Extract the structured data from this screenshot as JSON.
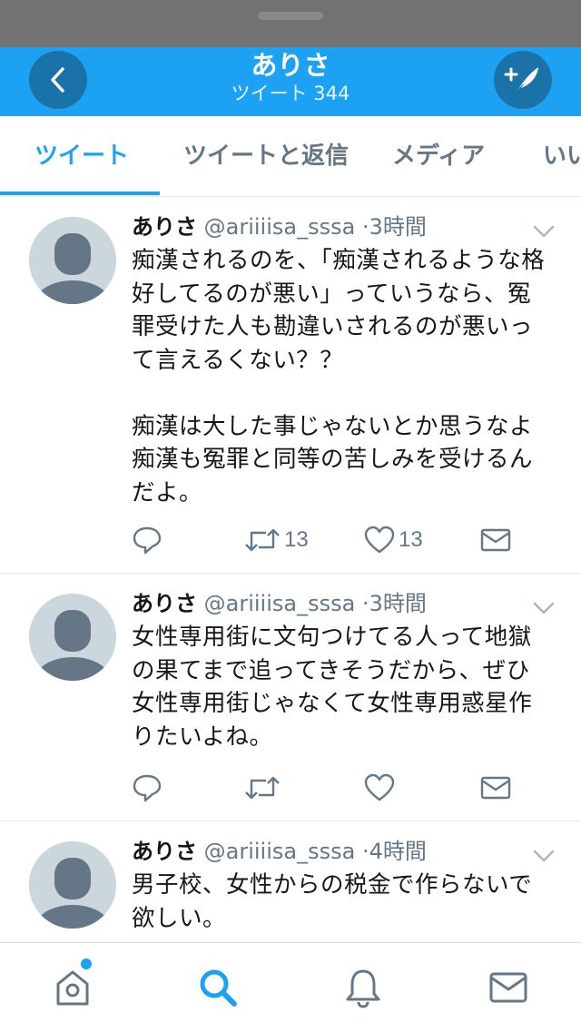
{
  "header": {
    "title": "ありさ",
    "subtitle_label": "ツイート",
    "subtitle_count": "344",
    "back_icon": "chevron-left-icon",
    "compose_icon": "compose-tweet-icon",
    "color": "#1da1f2"
  },
  "tabs": [
    {
      "label": "ツイート",
      "active": true
    },
    {
      "label": "ツイートと返信",
      "active": false
    },
    {
      "label": "メディア",
      "active": false
    },
    {
      "label": "いい",
      "active": false
    }
  ],
  "tweets": [
    {
      "name": "ありさ",
      "handle": "@ariiiisa_sssa",
      "time": "3時間",
      "text": "痴漢されるのを、「痴漢されるような格好してるのが悪い」っていうなら、冤罪受けた人も勘違いされるのが悪いって言えるくない？？\n\n痴漢は大した事じゃないとか思うなよ痴漢も冤罪と同等の苦しみを受けるんだよ。",
      "retweets": "13",
      "likes": "13"
    },
    {
      "name": "ありさ",
      "handle": "@ariiiisa_sssa",
      "time": "3時間",
      "text": "女性専用街に文句つけてる人って地獄の果てまで追ってきそうだから、ぜひ女性専用街じゃなくて女性専用惑星作りたいよね。",
      "retweets": "",
      "likes": ""
    },
    {
      "name": "ありさ",
      "handle": "@ariiiisa_sssa",
      "time": "4時間",
      "text": "男子校、女性からの税金で作らないで欲しい。",
      "retweets": "",
      "likes": ""
    }
  ],
  "bottom_nav": [
    {
      "icon": "home-icon",
      "active": false,
      "has_dot": true
    },
    {
      "icon": "search-icon",
      "active": true
    },
    {
      "icon": "notifications-bell-icon",
      "active": false
    },
    {
      "icon": "messages-envelope-icon",
      "active": false
    }
  ]
}
